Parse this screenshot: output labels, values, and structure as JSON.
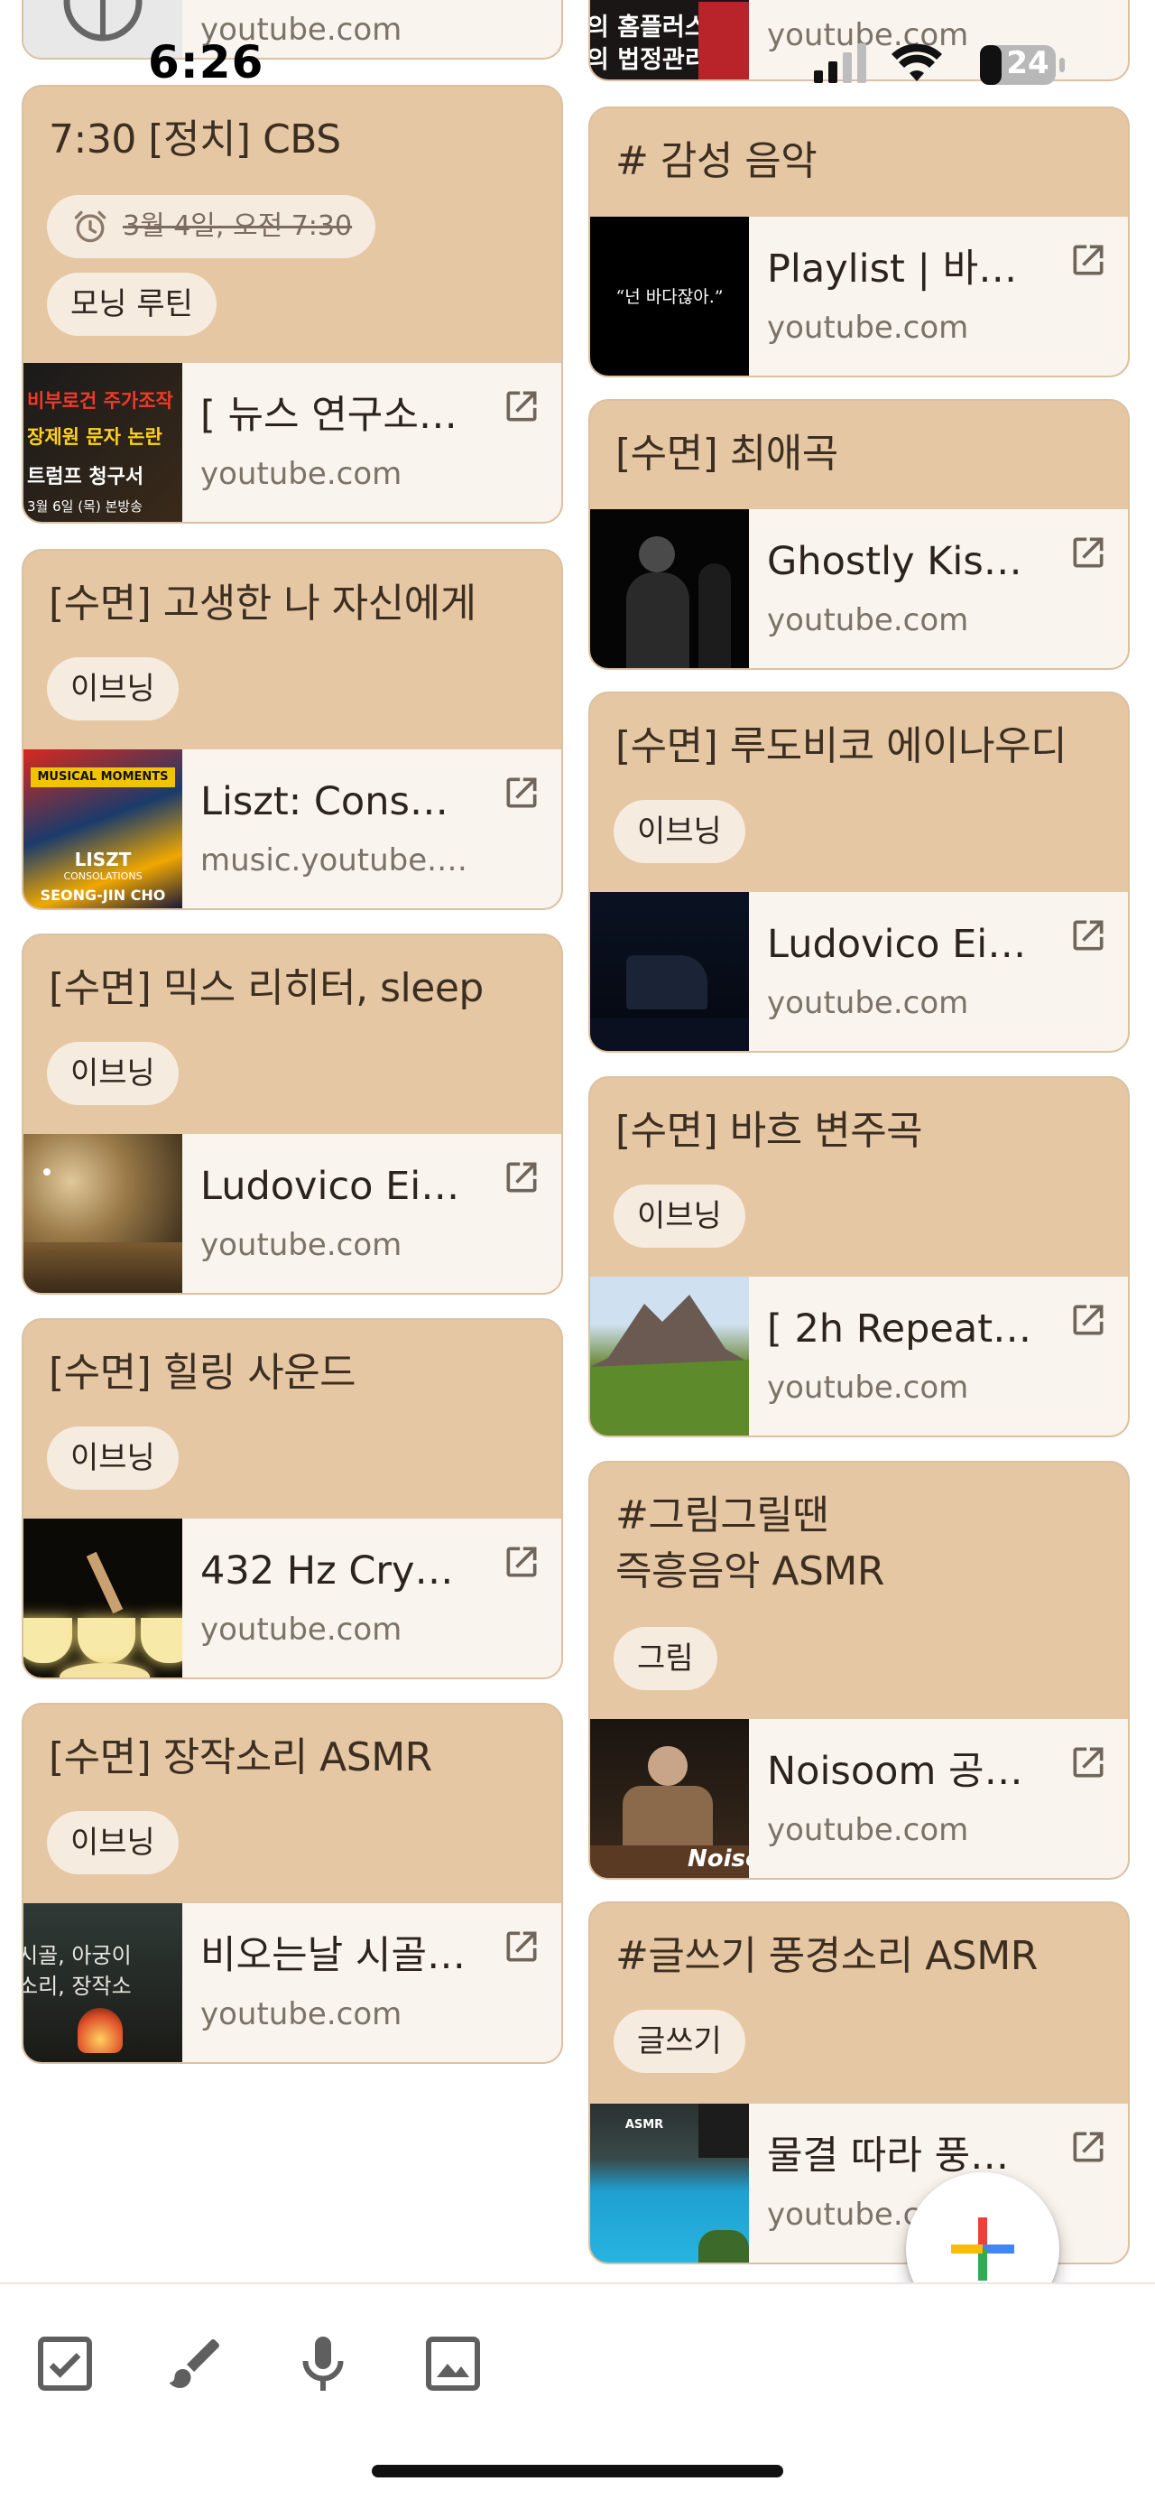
{
  "status_bar": {
    "time": "6:26",
    "battery": "24"
  },
  "left_column": {
    "top_card": {
      "domain": "youtube.com"
    },
    "cards": [
      {
        "title": "7:30 [정치] CBS",
        "reminder": "3월 4일, 오전 7:30",
        "label": "모닝 루틴",
        "link": {
          "title": "[ 뉴스 연구소]…",
          "domain": "youtube.com",
          "thumb_lines": [
            "비부로건 주가조작",
            "장제원 문자 논란",
            "트럼프 청구서",
            "3월 6일 (목) 본방송"
          ]
        }
      },
      {
        "title": "[수면] 고생한 나 자신에게",
        "label": "이브닝",
        "link": {
          "title": "Liszt: Consolat…",
          "domain": "music.youtube.c…",
          "thumb_lines": [
            "MUSICAL MOMENTS",
            "LISZT",
            "CONSOLATIONS",
            "SEONG-JIN CHO"
          ]
        }
      },
      {
        "title": "[수면] 믹스 리히터, sleep",
        "label": "이브닝",
        "link": {
          "title": "Ludovico Eina…",
          "domain": "youtube.com"
        }
      },
      {
        "title": "[수면] 힐링 사운드",
        "label": "이브닝",
        "link": {
          "title": "432 Hz Crystal…",
          "domain": "youtube.com"
        }
      },
      {
        "title": "[수면] 장작소리 ASMR",
        "label": "이브닝",
        "link": {
          "title": "비오는날 시골…",
          "domain": "youtube.com",
          "thumb_lines": [
            "시골, 아궁이",
            "소리, 장작소"
          ]
        }
      }
    ]
  },
  "right_column": {
    "top_card": {
      "domain": "youtube.com",
      "thumb_lines": [
        "의 홈플러스",
        "의 법정관리"
      ]
    },
    "cards": [
      {
        "title": "# 감성 음악",
        "link": {
          "title": "Playlist | 바다…",
          "domain": "youtube.com",
          "thumb_lines": [
            "“넌 바다잖아.”"
          ]
        }
      },
      {
        "title": "[수면] 최애곡",
        "link": {
          "title": "Ghostly Kisses…",
          "domain": "youtube.com"
        }
      },
      {
        "title": "[수면] 루도비코 에이나우디",
        "label": "이브닝",
        "link": {
          "title": "Ludovico Eina…",
          "domain": "youtube.com"
        }
      },
      {
        "title": "[수면] 바흐 변주곡",
        "label": "이브닝",
        "link": {
          "title": "[ 2h Repeat ]…",
          "domain": "youtube.com"
        }
      },
      {
        "title": "#그림그릴땐\n즉흥음악 ASMR",
        "label": "그림",
        "link": {
          "title": "Noisoom 공연…",
          "domain": "youtube.com",
          "thumb_lines": [
            "Noiso"
          ]
        }
      },
      {
        "title": "#글쓰기 풍경소리 ASMR",
        "label": "글쓰기",
        "link": {
          "title": "물결 따라 풍경…",
          "domain": "youtube.c",
          "thumb_lines": [
            "ASMR"
          ]
        }
      }
    ]
  },
  "toolbar": {
    "icons": [
      "checkbox-icon",
      "brush-icon",
      "microphone-icon",
      "image-icon"
    ]
  },
  "fab": {
    "icon": "plus-icon",
    "colors": [
      "#4285f4",
      "#ea4335",
      "#fbbc04",
      "#34a853"
    ]
  }
}
